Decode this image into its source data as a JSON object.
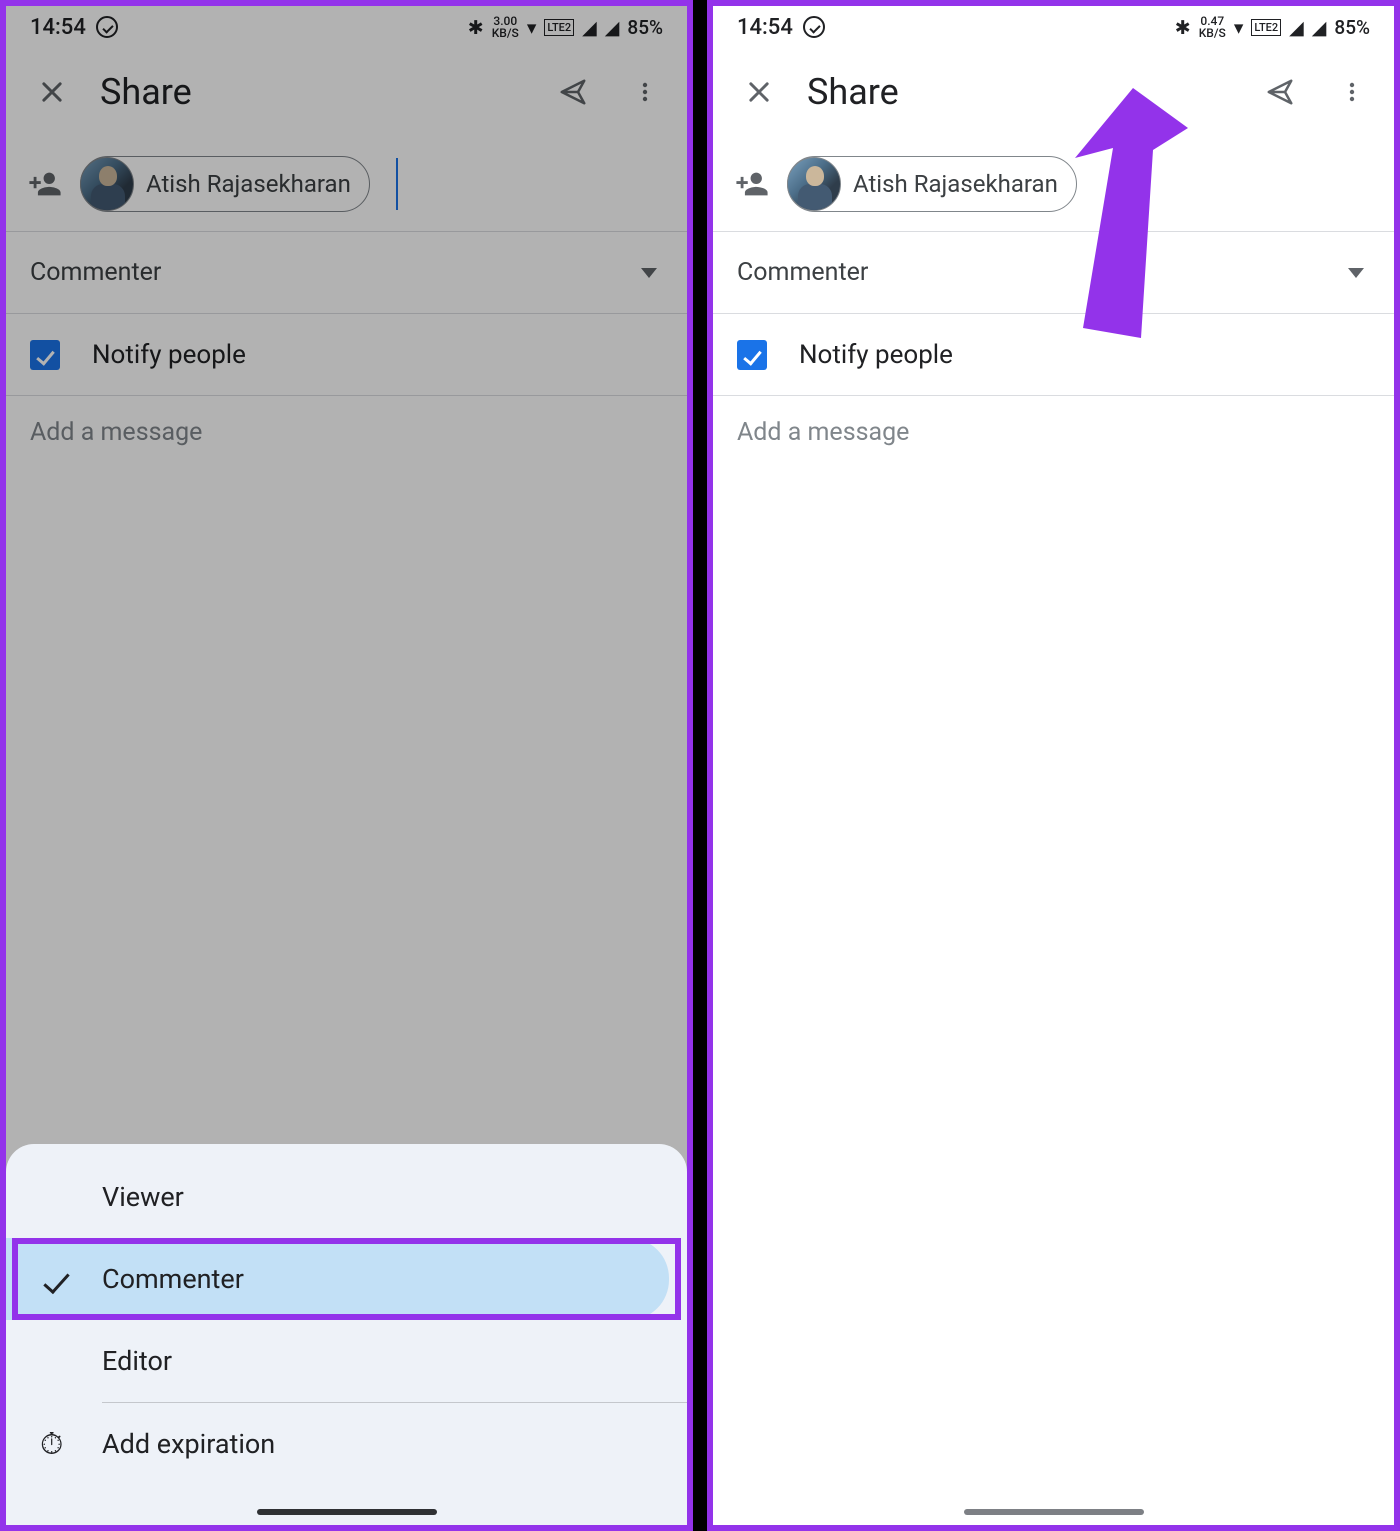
{
  "status": {
    "time": "14:54",
    "speed_left": {
      "top": "3.00",
      "bot": "KB/S"
    },
    "speed_right": {
      "top": "0.47",
      "bot": "KB/S"
    },
    "lte": "LTE2",
    "battery": "85%"
  },
  "header": {
    "title": "Share"
  },
  "person": {
    "name": "Atish Rajasekharan"
  },
  "role": {
    "selected": "Commenter"
  },
  "notify": {
    "label": "Notify people"
  },
  "message": {
    "placeholder": "Add a message"
  },
  "sheet": {
    "viewer": "Viewer",
    "commenter": "Commenter",
    "editor": "Editor",
    "expiration": "Add expiration"
  }
}
